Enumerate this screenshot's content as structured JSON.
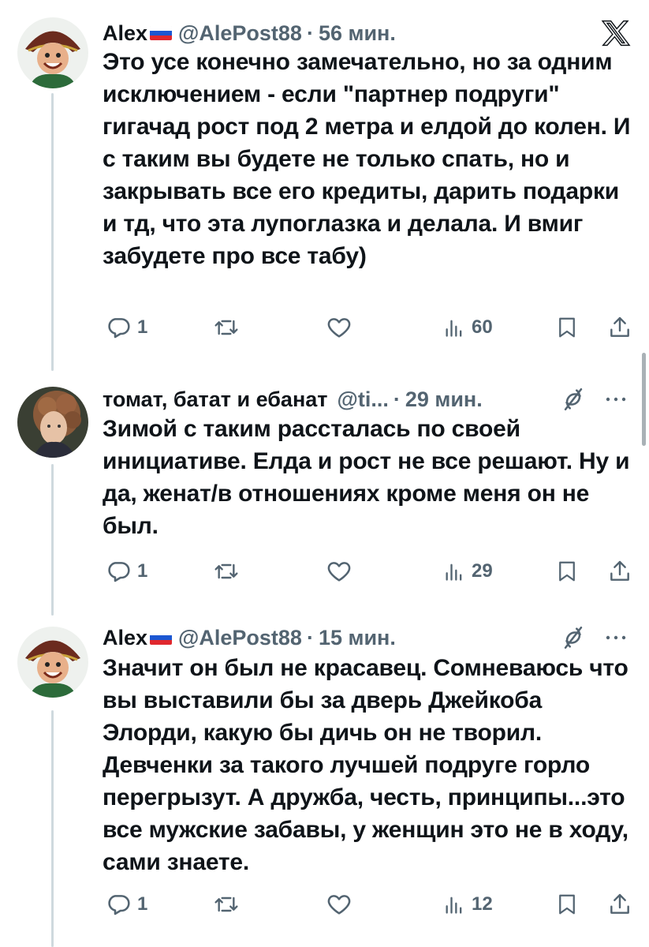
{
  "tweets": [
    {
      "display_name": "Alex",
      "handle": "@AlePost88",
      "separator": "·",
      "time": "56 мин.",
      "text": "Это усе конечно замечательно, но за одним исключением - если \"партнер подруги\" гигачад рост под 2 метра и елдой до колен. И с таким вы будете не только спать, но и закрывать все его кредиты, дарить подарки и тд, что эта лупоглазка и делала. И вмиг забудете про все табу)",
      "replies": "1",
      "views": "60",
      "corner_icon": "x-logo-icon"
    },
    {
      "display_name": "томат, батат и ебанат",
      "handle": "@ti...",
      "separator": "·",
      "time": "29 мин.",
      "text": "Зимой с таким рассталась по своей инициативе. Елда и рост не все решают. Ну и да, женат/в отношениях кроме меня он не был.",
      "replies": "1",
      "views": "29",
      "corner_icon": "grok-icon"
    },
    {
      "display_name": "Alex",
      "handle": "@AlePost88",
      "separator": "·",
      "time": "15 мин.",
      "text": "Значит он был не красавец. Сомневаюсь что вы выставили бы за дверь Джейкоба Элорди, какую бы дичь он не творил. Девченки за такого лучшей подруге горло перегрызут. А дружба, честь, принципы...это все мужские забавы, у женщин это не в ходу, сами знаете.",
      "replies": "1",
      "views": "12",
      "corner_icon": "grok-icon"
    }
  ],
  "colors": {
    "text": "#0f1419",
    "secondary": "#536471",
    "thread_line": "#cfd9de"
  }
}
